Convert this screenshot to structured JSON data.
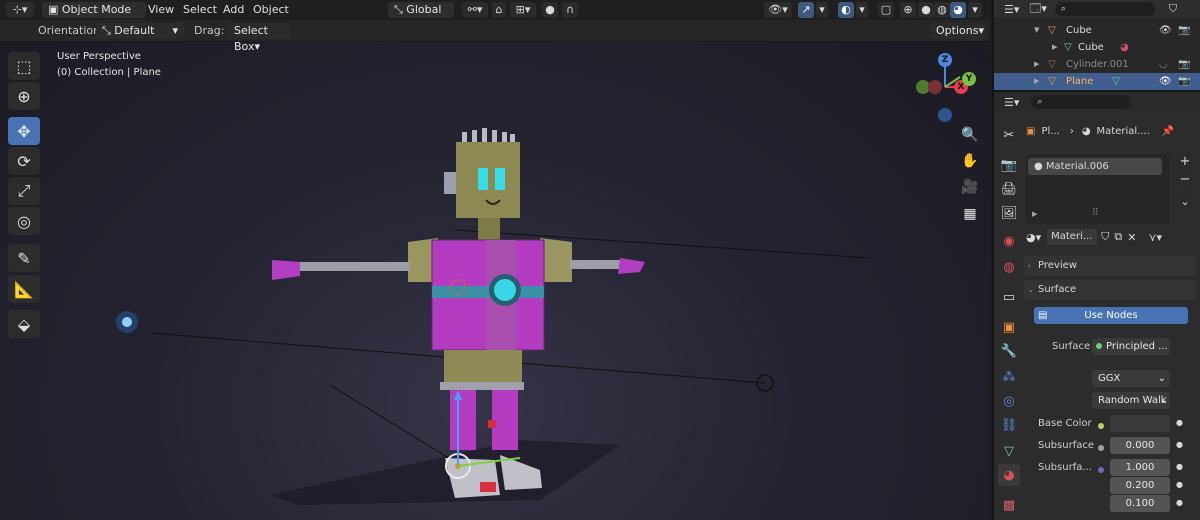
{
  "header": {
    "mode_label": "Object Mode",
    "menus": [
      "View",
      "Select",
      "Add",
      "Object"
    ],
    "transform_orientation": "Global"
  },
  "toolbar2": {
    "orientation_label": "Orientation:",
    "orientation_value": "Default",
    "drag_label": "Drag:",
    "drag_value": "Select Box",
    "options_label": "Options"
  },
  "viewport": {
    "perspective_label": "User Perspective",
    "collection_label": "(0) Collection | Plane",
    "axes": {
      "z": "Z",
      "x": "X",
      "y": "Y"
    }
  },
  "outliner": {
    "rows": [
      {
        "label": "Cube",
        "icon": "mesh-object-icon",
        "selected": false
      },
      {
        "label": "Cube",
        "icon": "mesh-data-icon",
        "selected": false
      },
      {
        "label": "Cylinder.001",
        "icon": "mesh-object-icon",
        "selected": false
      },
      {
        "label": "Plane",
        "icon": "mesh-object-icon",
        "selected": true
      }
    ]
  },
  "properties": {
    "breadcrumb_object": "Pl...",
    "breadcrumb_material": "Material....",
    "slot_name": "Material.006",
    "material_field": "Materi...",
    "preview_label": "Preview",
    "surface_section": "Surface",
    "use_nodes_label": "Use Nodes",
    "surface_label": "Surface",
    "surface_value": "Principled ...",
    "distribution": "GGX",
    "subsurface_method": "Random Walk",
    "base_color_label": "Base Color",
    "subsurface_label": "Subsurface",
    "subsurface_value": "0.000",
    "subsurface_radius_label": "Subsurfa...",
    "radius_values": [
      "1.000",
      "0.200",
      "0.100"
    ]
  },
  "colors": {
    "accent_blue": "#4772b3",
    "selected_row": "#3f5e8e",
    "robot_magenta": "#b43cc0",
    "robot_olive": "#8f8a55",
    "robot_cyan": "#38d6e6"
  }
}
